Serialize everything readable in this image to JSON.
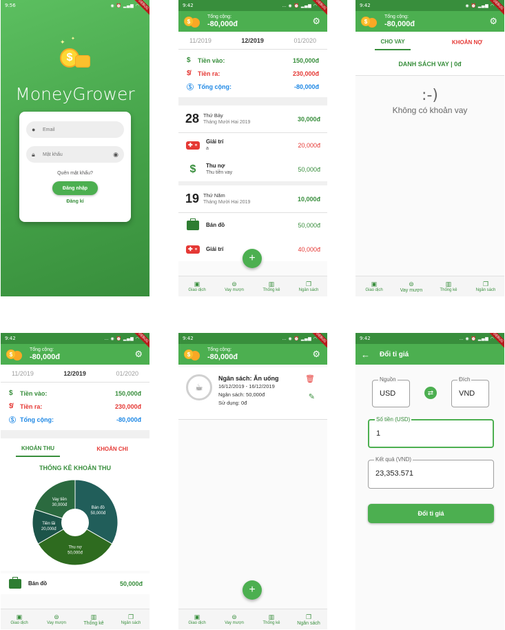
{
  "colors": {
    "primary": "#4caf50",
    "primary_dark": "#388e3c",
    "income": "#388e3c",
    "expense": "#e53935",
    "total": "#1e88e5"
  },
  "debug_label": "DEBUG",
  "login": {
    "time": "9:56",
    "app_name": "MoneyGrower",
    "email_placeholder": "Email",
    "password_placeholder": "Mật khẩu",
    "forgot_password": "Quên mật khẩu?",
    "login_button": "Đăng nhập",
    "register_link": "Đăng kí"
  },
  "header": {
    "total_label": "Tổng cộng:",
    "total_value": "-80,000đ"
  },
  "time_short": "9:42",
  "months": {
    "prev": "11/2019",
    "current": "12/2019",
    "next": "01/2020"
  },
  "summary": {
    "income_label": "Tiền vào:",
    "income_value": "150,000đ",
    "expense_label": "Tiền ra:",
    "expense_value": "230,000đ",
    "total_label": "Tổng cộng:",
    "total_value": "-80,000đ"
  },
  "transactions": {
    "day1": {
      "day": "28",
      "weekday": "Thứ Bảy",
      "month_year": "Tháng Mười Hai 2019",
      "amount": "30,000đ",
      "items": [
        {
          "title": "Giải trí",
          "note": "a",
          "amount": "20,000đ"
        },
        {
          "title": "Thu nợ",
          "note": "Thu tiền vay",
          "amount": "50,000đ"
        }
      ]
    },
    "day2": {
      "day": "19",
      "weekday": "Thứ Năm",
      "month_year": "Tháng Mười Hai 2019",
      "amount": "10,000đ",
      "items": [
        {
          "title": "Bán đồ",
          "note": "",
          "amount": "50,000đ"
        },
        {
          "title": "Giải trí",
          "note": "",
          "amount": "40,000đ"
        }
      ]
    }
  },
  "nav": {
    "transactions": "Giao dịch",
    "loans": "Vay mượn",
    "stats": "Thống kê",
    "budget": "Ngân sách"
  },
  "loans": {
    "tab_lend": "CHO VAY",
    "tab_debt": "KHOẢN NỢ",
    "list_title": "DANH SÁCH VAY | 0đ",
    "emoticon": ":-)",
    "empty_text": "Không có khoản vay"
  },
  "stats": {
    "tab_income": "KHOẢN THU",
    "tab_expense": "KHOẢN CHI",
    "chart_title": "THỐNG KÊ KHOẢN THU",
    "item_title": "Bán đồ",
    "item_amount": "50,000đ"
  },
  "chart_data": {
    "type": "pie",
    "title": "THỐNG KÊ KHOẢN THU",
    "slices": [
      {
        "label": "Bán đồ",
        "value_label": "50,000đ",
        "value": 50000,
        "color": "#215e5a"
      },
      {
        "label": "Thu nợ",
        "value_label": "50,000đ",
        "value": 50000,
        "color": "#2e6b1f"
      },
      {
        "label": "Tiền lãi",
        "value_label": "20,000đ",
        "value": 20000,
        "color": "#1c5449"
      },
      {
        "label": "Vay tiền",
        "value_label": "30,000đ",
        "value": 30000,
        "color": "#2b6a3f"
      }
    ]
  },
  "budget": {
    "title": "Ngân sách: Ăn uống",
    "date_range": "16/12/2019 - 16/12/2019",
    "amount": "Ngân sách: 50,000đ",
    "used": "Sử dụng: 0đ"
  },
  "exchange": {
    "title": "Đổi tỉ giá",
    "source_label": "Nguồn",
    "source_value": "USD",
    "target_label": "Đích",
    "target_value": "VND",
    "amount_label": "Số tiền (USD)",
    "amount_value": "1",
    "result_label": "Kết quả (VND)",
    "result_value": "23,353.571",
    "convert_button": "Đổi tỉ giá"
  }
}
